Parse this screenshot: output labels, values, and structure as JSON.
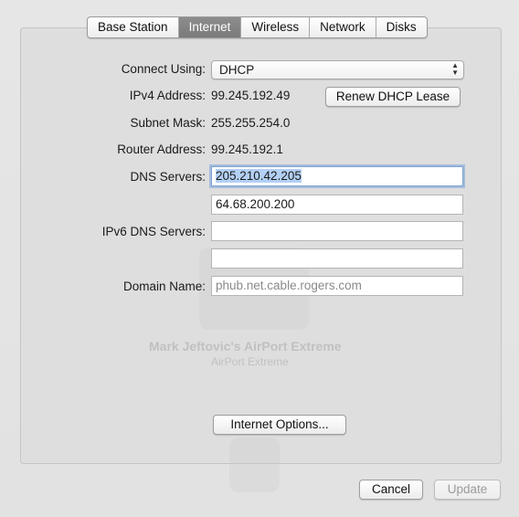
{
  "tabs": [
    {
      "label": "Base Station",
      "active": false
    },
    {
      "label": "Internet",
      "active": true
    },
    {
      "label": "Wireless",
      "active": false
    },
    {
      "label": "Network",
      "active": false
    },
    {
      "label": "Disks",
      "active": false
    }
  ],
  "form": {
    "connect_using_label": "Connect Using:",
    "connect_using_value": "DHCP",
    "ipv4_label": "IPv4 Address:",
    "ipv4_value": "99.245.192.49",
    "renew_button": "Renew DHCP Lease",
    "subnet_label": "Subnet Mask:",
    "subnet_value": "255.255.254.0",
    "router_label": "Router Address:",
    "router_value": "99.245.192.1",
    "dns_label": "DNS Servers:",
    "dns1_value": "205.210.42.205",
    "dns2_value": "64.68.200.200",
    "ipv6_dns_label": "IPv6 DNS Servers:",
    "ipv6_dns1_value": "",
    "ipv6_dns2_value": "",
    "domain_label": "Domain Name:",
    "domain_placeholder": "phub.net.cable.rogers.com"
  },
  "background_ghost": {
    "device_name": "Mark Jeftovic's AirPort Extreme",
    "device_type": "AirPort Extreme"
  },
  "buttons": {
    "internet_options": "Internet Options...",
    "cancel": "Cancel",
    "update": "Update"
  },
  "colors": {
    "active_tab": "#7f7f7f",
    "focus_ring": "#7da2ce",
    "selection": "#b3d0f5"
  }
}
